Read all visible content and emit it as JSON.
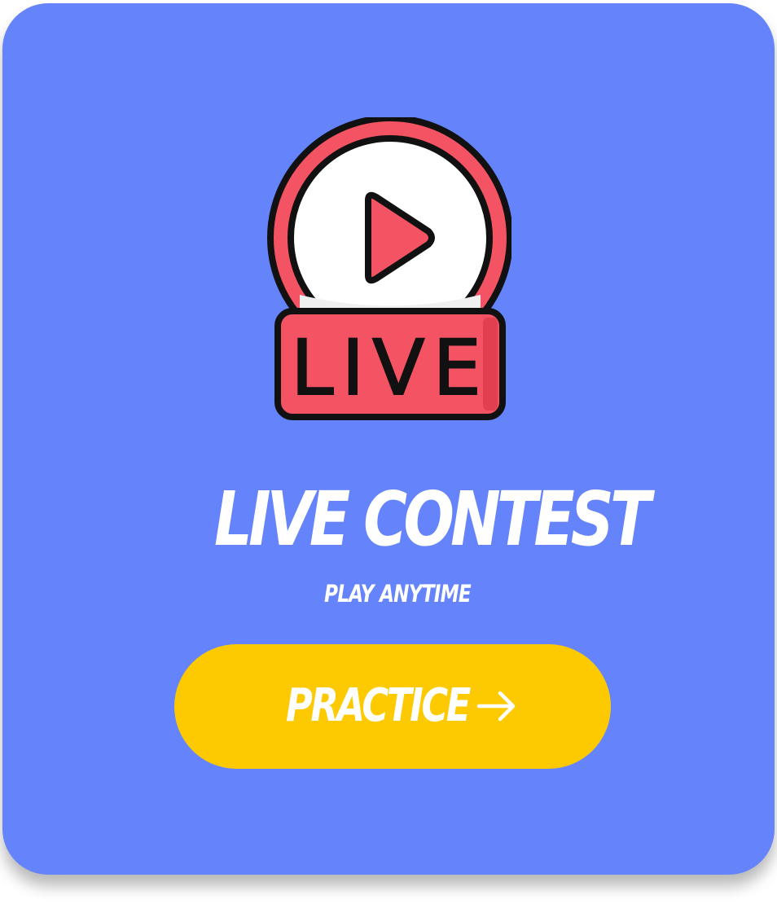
{
  "card": {
    "background_color": "#6584fb",
    "icon": {
      "name": "live-stream-icon",
      "label": "LIVE",
      "accent_color": "#f45363",
      "outline_color": "#111111"
    },
    "title": "LIVE CONTEST",
    "subtitle": "PLAY ANYTIME",
    "cta": {
      "label": "PRACTICE",
      "icon": "arrow-right-icon",
      "background_color": "#fdca02"
    }
  }
}
